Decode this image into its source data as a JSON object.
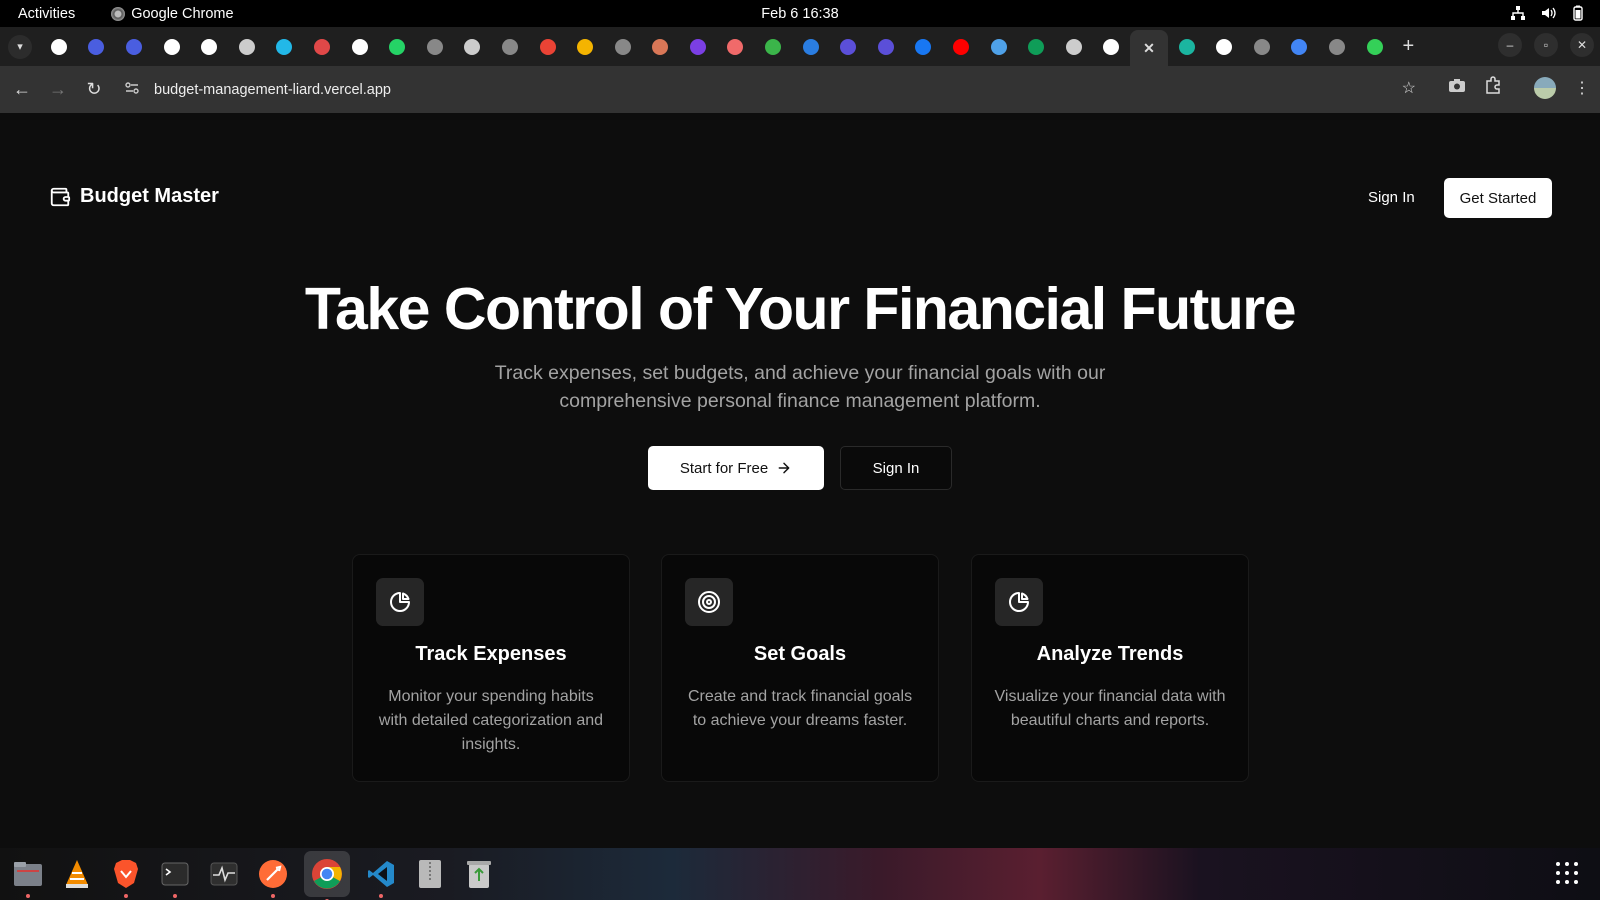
{
  "system": {
    "activities": "Activities",
    "app_name": "Google Chrome",
    "clock": "Feb 6  16:38"
  },
  "browser": {
    "url": "budget-management-liard.vercel.app",
    "tab_favicons": [
      {
        "name": "circle-logo",
        "color": "#ffffff"
      },
      {
        "name": "gravatar",
        "color": "#4a5ee0"
      },
      {
        "name": "gravatar",
        "color": "#4a5ee0"
      },
      {
        "name": "github",
        "color": "#ffffff"
      },
      {
        "name": "github",
        "color": "#ffffff"
      },
      {
        "name": "openai",
        "color": "#cccccc"
      },
      {
        "name": "dot-cyan",
        "color": "#22b8e8"
      },
      {
        "name": "calendar-red",
        "color": "#e04848"
      },
      {
        "name": "pen-white",
        "color": "#ffffff"
      },
      {
        "name": "whatsapp",
        "color": "#25d366"
      },
      {
        "name": "globe",
        "color": "#888888"
      },
      {
        "name": "wordpress",
        "color": "#cccccc"
      },
      {
        "name": "globe",
        "color": "#888888"
      },
      {
        "name": "gmail",
        "color": "#ea4335"
      },
      {
        "name": "photos",
        "color": "#f4b400"
      },
      {
        "name": "globe",
        "color": "#888888"
      },
      {
        "name": "claude",
        "color": "#d97757"
      },
      {
        "name": "bold-b",
        "color": "#7b3fe4"
      },
      {
        "name": "asana",
        "color": "#f06a6a"
      },
      {
        "name": "green-s",
        "color": "#3bb54a"
      },
      {
        "name": "th",
        "color": "#2a7de1"
      },
      {
        "name": "shield-purple",
        "color": "#5b4fd8"
      },
      {
        "name": "shield-purple",
        "color": "#5b4fd8"
      },
      {
        "name": "facebook",
        "color": "#1877f2"
      },
      {
        "name": "youtube",
        "color": "#ff0000"
      },
      {
        "name": "wordpress",
        "color": "#4fa1e8"
      },
      {
        "name": "sheets",
        "color": "#0f9d58"
      },
      {
        "name": "chrome",
        "color": "#cccccc"
      },
      {
        "name": "vercel",
        "color": "#ffffff"
      },
      {
        "name": "close",
        "color": "#dddddd",
        "active": true
      },
      {
        "name": "diamond-teal",
        "color": "#1bb5a0"
      },
      {
        "name": "bold-b-dark",
        "color": "#ffffff"
      },
      {
        "name": "globe",
        "color": "#888888"
      },
      {
        "name": "google",
        "color": "#4285f4"
      },
      {
        "name": "globe",
        "color": "#888888"
      },
      {
        "name": "bolt-green",
        "color": "#34d058"
      }
    ]
  },
  "page": {
    "brand": "Budget Master",
    "nav": {
      "sign_in": "Sign In",
      "get_started": "Get Started"
    },
    "hero": {
      "title": "Take Control of Your Financial Future",
      "subtitle": "Track expenses, set budgets, and achieve your financial goals with our comprehensive personal finance management platform.",
      "primary_cta": "Start for Free",
      "secondary_cta": "Sign In"
    },
    "features": [
      {
        "icon": "pie-chart-icon",
        "title": "Track Expenses",
        "description": "Monitor your spending habits with detailed categorization and insights."
      },
      {
        "icon": "target-icon",
        "title": "Set Goals",
        "description": "Create and track financial goals to achieve your dreams faster."
      },
      {
        "icon": "pie-chart-icon",
        "title": "Analyze Trends",
        "description": "Visualize your financial data with beautiful charts and reports."
      }
    ]
  },
  "dock": {
    "apps": [
      "files",
      "vlc",
      "brave",
      "terminal",
      "system-monitor",
      "postman",
      "chrome",
      "vscode",
      "archive",
      "trash"
    ]
  }
}
